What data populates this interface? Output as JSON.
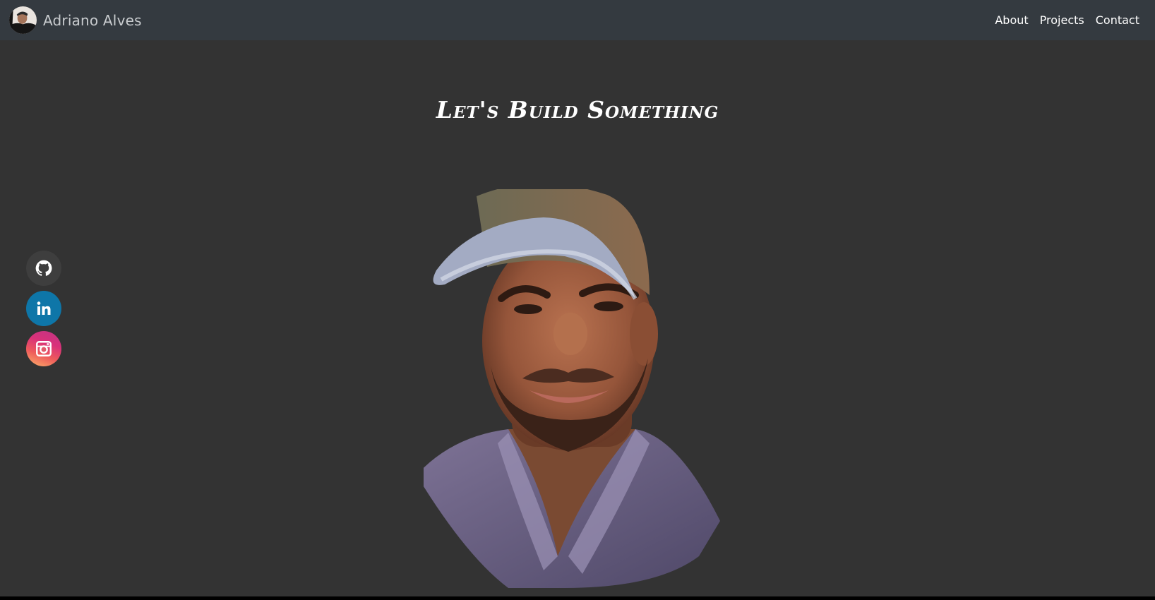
{
  "header": {
    "brand_name": "Adriano Alves",
    "nav": [
      {
        "label": "About"
      },
      {
        "label": "Projects"
      },
      {
        "label": "Contact"
      }
    ]
  },
  "hero": {
    "title": "Let's Build Something"
  },
  "socials": [
    {
      "icon": "github-icon",
      "color": "#3e3e3e"
    },
    {
      "icon": "linkedin-icon",
      "color": "#0e76a8"
    },
    {
      "icon": "instagram-icon",
      "color": "#d9317a"
    }
  ],
  "colors": {
    "background": "#333333",
    "navbar": "#343a40"
  }
}
